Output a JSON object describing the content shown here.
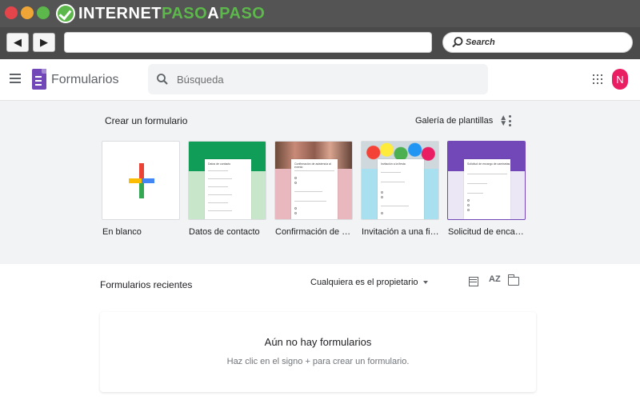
{
  "browser": {
    "brand_part1": "INTERNET",
    "brand_part2": "PASO",
    "brand_part3": "A",
    "brand_part4": "PASO",
    "back_icon": "◀",
    "forward_icon": "▶",
    "search_placeholder": "Search"
  },
  "header": {
    "app_name": "Formularios",
    "search_placeholder": "Búsqueda",
    "avatar_initial": "N"
  },
  "templates": {
    "heading": "Crear un formulario",
    "gallery_label": "Galería de plantillas",
    "items": [
      {
        "label": "En blanco"
      },
      {
        "label": "Datos de contacto"
      },
      {
        "label": "Confirmación de asistencia al evento"
      },
      {
        "label": "Invitación a una fiesta"
      },
      {
        "label": "Solicitud de encargo de camisetas"
      }
    ]
  },
  "recent": {
    "title": "Formularios recientes",
    "owner_filter": "Cualquiera es el propietario",
    "sort_label": "AZ",
    "empty_title": "Aún no hay formularios",
    "empty_subtitle": "Haz clic en el signo + para crear un formulario."
  },
  "colors": {
    "forms_purple": "#7248b9",
    "contact_green": "#0f9d58",
    "rsvp_pink": "#e8b8be",
    "party_blue": "#a8e0f0",
    "shirt_purple": "#7248b9",
    "avatar": "#e91e63"
  }
}
